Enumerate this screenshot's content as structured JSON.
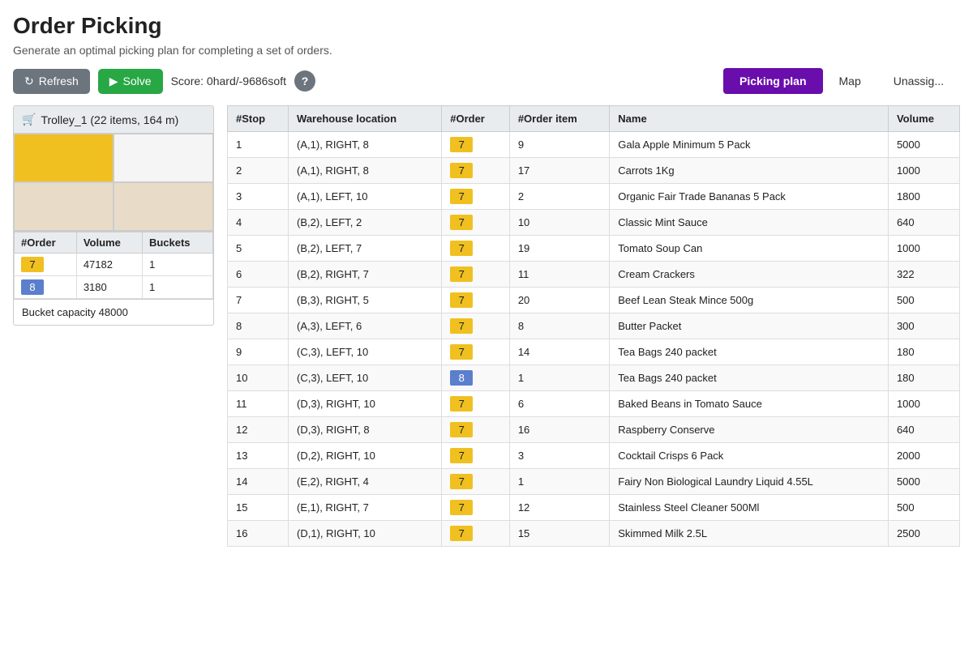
{
  "page": {
    "title": "Order Picking",
    "subtitle": "Generate an optimal picking plan for completing a set of orders."
  },
  "toolbar": {
    "refresh_label": "Refresh",
    "solve_label": "Solve",
    "score_label": "Score: 0hard/-9686soft",
    "help_label": "?"
  },
  "nav": {
    "tabs": [
      {
        "label": "Picking plan",
        "active": true
      },
      {
        "label": "Map",
        "active": false
      },
      {
        "label": "Unassig...",
        "active": false
      }
    ]
  },
  "trolley": {
    "title": "Trolley_1",
    "subtitle": "(22 items, 164 m)",
    "bucket_capacity": "Bucket capacity 48000",
    "orders": [
      {
        "id": "7",
        "color": "yellow",
        "volume": 47182,
        "buckets": 1
      },
      {
        "id": "8",
        "color": "blue",
        "volume": 3180,
        "buckets": 1
      }
    ],
    "columns": [
      "#Order",
      "Volume",
      "Buckets"
    ]
  },
  "table": {
    "columns": [
      "#Stop",
      "Warehouse location",
      "#Order",
      "#Order item",
      "Name",
      "Volume"
    ],
    "rows": [
      {
        "stop": 1,
        "location": "(A,1), RIGHT, 8",
        "order": 7,
        "order_item": 9,
        "name": "Gala Apple Minimum 5 Pack",
        "volume": 5000
      },
      {
        "stop": 2,
        "location": "(A,1), RIGHT, 8",
        "order": 7,
        "order_item": 17,
        "name": "Carrots 1Kg",
        "volume": 1000
      },
      {
        "stop": 3,
        "location": "(A,1), LEFT, 10",
        "order": 7,
        "order_item": 2,
        "name": "Organic Fair Trade Bananas 5 Pack",
        "volume": 1800
      },
      {
        "stop": 4,
        "location": "(B,2), LEFT, 2",
        "order": 7,
        "order_item": 10,
        "name": "Classic Mint Sauce",
        "volume": 640
      },
      {
        "stop": 5,
        "location": "(B,2), LEFT, 7",
        "order": 7,
        "order_item": 19,
        "name": "Tomato Soup Can",
        "volume": 1000
      },
      {
        "stop": 6,
        "location": "(B,2), RIGHT, 7",
        "order": 7,
        "order_item": 11,
        "name": "Cream Crackers",
        "volume": 322
      },
      {
        "stop": 7,
        "location": "(B,3), RIGHT, 5",
        "order": 7,
        "order_item": 20,
        "name": "Beef Lean Steak Mince 500g",
        "volume": 500
      },
      {
        "stop": 8,
        "location": "(A,3), LEFT, 6",
        "order": 7,
        "order_item": 8,
        "name": "Butter Packet",
        "volume": 300
      },
      {
        "stop": 9,
        "location": "(C,3), LEFT, 10",
        "order": 7,
        "order_item": 14,
        "name": "Tea Bags 240 packet",
        "volume": 180
      },
      {
        "stop": 10,
        "location": "(C,3), LEFT, 10",
        "order": 8,
        "order_item": 1,
        "name": "Tea Bags 240 packet",
        "volume": 180
      },
      {
        "stop": 11,
        "location": "(D,3), RIGHT, 10",
        "order": 7,
        "order_item": 6,
        "name": "Baked Beans in Tomato Sauce",
        "volume": 1000
      },
      {
        "stop": 12,
        "location": "(D,3), RIGHT, 8",
        "order": 7,
        "order_item": 16,
        "name": "Raspberry Conserve",
        "volume": 640
      },
      {
        "stop": 13,
        "location": "(D,2), RIGHT, 10",
        "order": 7,
        "order_item": 3,
        "name": "Cocktail Crisps 6 Pack",
        "volume": 2000
      },
      {
        "stop": 14,
        "location": "(E,2), RIGHT, 4",
        "order": 7,
        "order_item": 1,
        "name": "Fairy Non Biological Laundry Liquid 4.55L",
        "volume": 5000
      },
      {
        "stop": 15,
        "location": "(E,1), RIGHT, 7",
        "order": 7,
        "order_item": 12,
        "name": "Stainless Steel Cleaner 500Ml",
        "volume": 500
      },
      {
        "stop": 16,
        "location": "(D,1), RIGHT, 10",
        "order": 7,
        "order_item": 15,
        "name": "Skimmed Milk 2.5L",
        "volume": 2500
      }
    ]
  }
}
